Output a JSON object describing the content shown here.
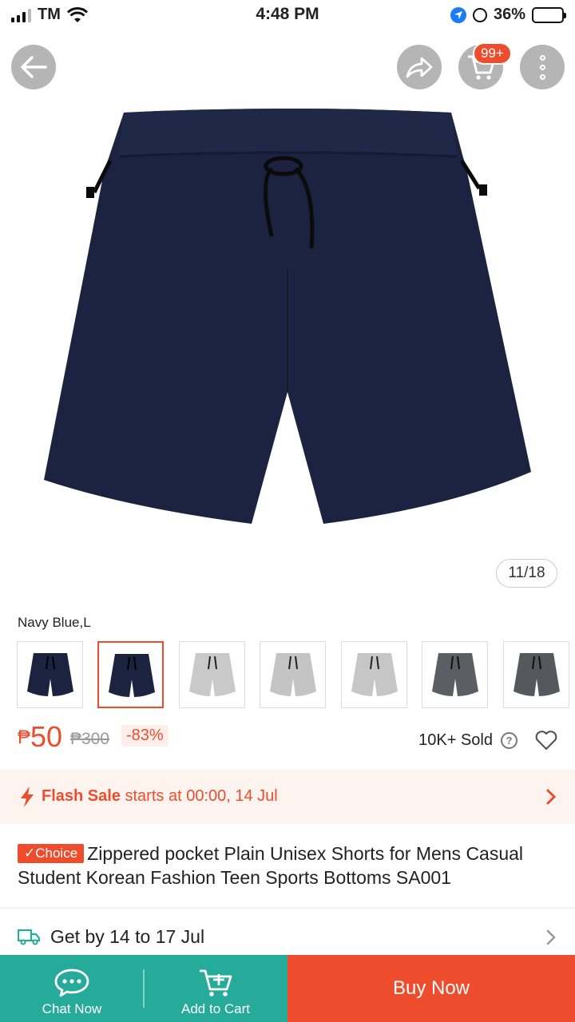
{
  "status_bar": {
    "carrier": "TM",
    "time": "4:48 PM",
    "battery": "36%"
  },
  "header": {
    "back_icon": "arrow-left-icon",
    "share_icon": "share-icon",
    "cart_icon": "cart-icon",
    "cart_badge": "99+",
    "more_icon": "more-vertical-icon"
  },
  "gallery": {
    "counter": "11/18",
    "selected_variant_label": "Navy Blue,L",
    "thumbnails": [
      {
        "color": "navy",
        "selected": false
      },
      {
        "color": "navy",
        "selected": true
      },
      {
        "color": "light-gray",
        "selected": false
      },
      {
        "color": "light-gray",
        "selected": false
      },
      {
        "color": "light-gray",
        "selected": false
      },
      {
        "color": "dark-gray",
        "selected": false
      },
      {
        "color": "dark-gray",
        "selected": false
      },
      {
        "color": "dark-gray",
        "selected": false
      }
    ]
  },
  "price": {
    "currency": "₱",
    "current": "50",
    "original": "₱300",
    "discount": "-83%",
    "sold": "10K+ Sold"
  },
  "flash_sale": {
    "label": "Flash Sale",
    "text": "starts at 00:00, 14 Jul"
  },
  "product": {
    "badge": "✓Choice",
    "title": "Zippered pocket Plain Unisex Shorts for Mens Casual Student Korean Fashion Teen Sports Bottoms SA001"
  },
  "delivery": {
    "text": "Get by 14 to 17 Jul"
  },
  "bottom_bar": {
    "chat_label": "Chat Now",
    "cart_label": "Add to Cart",
    "buy_label": "Buy Now"
  },
  "colors": {
    "brand": "#ee4d2d",
    "green": "#26aa99",
    "navy": "#1b2340"
  }
}
